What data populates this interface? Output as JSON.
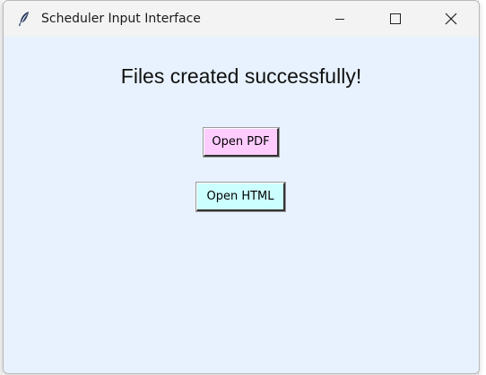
{
  "window": {
    "title": "Scheduler Input Interface",
    "app_icon": "feather-icon",
    "controls": [
      "minimize-icon",
      "maximize-icon",
      "close-icon"
    ]
  },
  "content": {
    "message": "Files created successfully!",
    "buttons": {
      "open_pdf": "Open PDF",
      "open_html": "Open HTML"
    }
  },
  "colors": {
    "window_background": "#e8f2ff",
    "titlebar": "#f3f3f3",
    "pdf_button": "#ffccff",
    "html_button": "#ccffff"
  }
}
